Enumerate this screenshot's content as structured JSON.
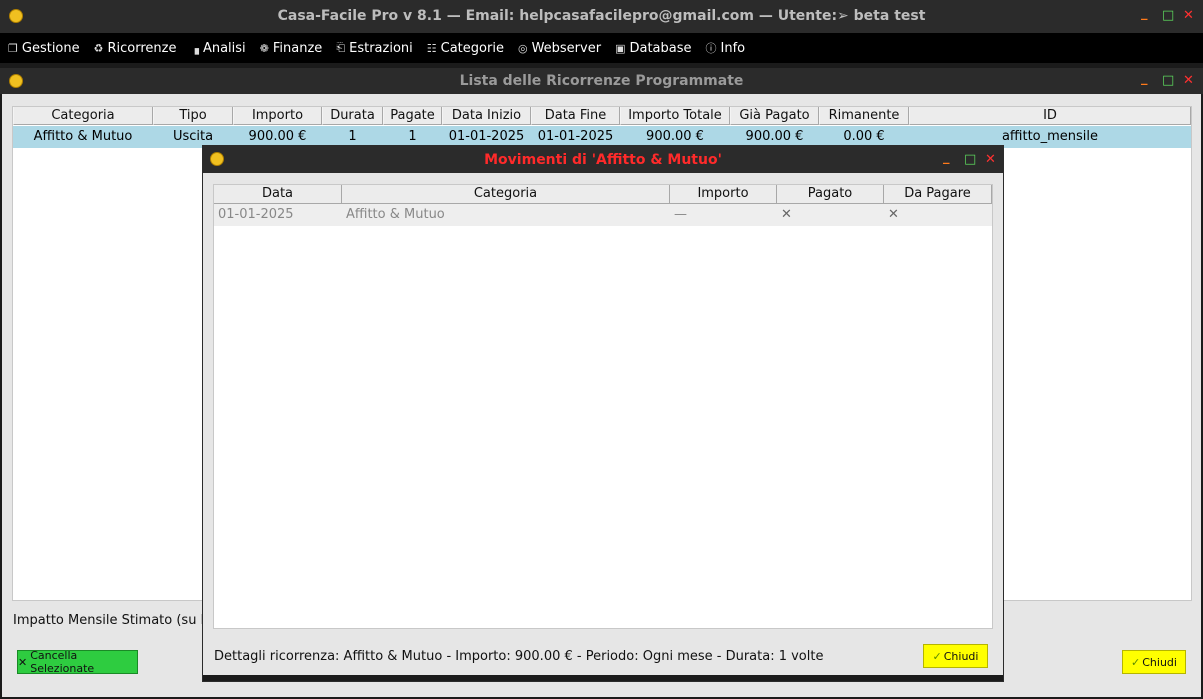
{
  "window": {
    "title": "Casa-Facile Pro v 8.1  — Email: helpcasafacilepro@gmail.com —  Utente:➢ beta test",
    "controls": {
      "minimize": "_",
      "maximize": "□",
      "close": "✕"
    }
  },
  "menu": [
    {
      "icon": "folder-icon",
      "glyph": "❐",
      "label": "Gestione"
    },
    {
      "icon": "recycle-icon",
      "glyph": "♻",
      "label": "Ricorrenze"
    },
    {
      "icon": "chart-icon",
      "glyph": "▗",
      "label": "Analisi"
    },
    {
      "icon": "coins-icon",
      "glyph": "❁",
      "label": "Finanze"
    },
    {
      "icon": "extract-icon",
      "glyph": "⎗",
      "label": "Estrazioni"
    },
    {
      "icon": "category-icon",
      "glyph": "☷",
      "label": "Categorie"
    },
    {
      "icon": "globe-icon",
      "glyph": "◎",
      "label": "Webserver"
    },
    {
      "icon": "save-icon",
      "glyph": "▣",
      "label": "Database"
    },
    {
      "icon": "info-icon",
      "glyph": "ⓘ",
      "label": "Info"
    }
  ],
  "list_window": {
    "title": "Lista delle Ricorrenze Programmate",
    "columns": [
      "Categoria",
      "Tipo",
      "Importo",
      "Durata",
      "Pagate",
      "Data Inizio",
      "Data Fine",
      "Importo Totale",
      "Già Pagato",
      "Rimanente",
      "ID"
    ],
    "rows": [
      [
        "Affitto & Mutuo",
        "Uscita",
        "900.00 €",
        "1",
        "1",
        "01-01-2025",
        "01-01-2025",
        "900.00 €",
        "900.00 €",
        "0.00 €",
        "affitto_mensile"
      ]
    ],
    "impact_label": "Impatto Mensile Stimato (su bas",
    "delete_button": "Cancella Selezionate",
    "close_button": "Chiudi"
  },
  "dialog": {
    "title": "Movimenti di 'Affitto & Mutuo'",
    "columns": [
      "Data",
      "Categoria",
      "Importo",
      "Pagato",
      "Da Pagare"
    ],
    "rows": [
      [
        "01-01-2025",
        "Affitto & Mutuo",
        "—",
        "✕",
        "✕"
      ]
    ],
    "details": "Dettagli ricorrenza: Affitto & Mutuo - Importo: 900.00 € - Periodo: Ogni mese - Durata: 1 volte",
    "close_button": "Chiudi"
  }
}
